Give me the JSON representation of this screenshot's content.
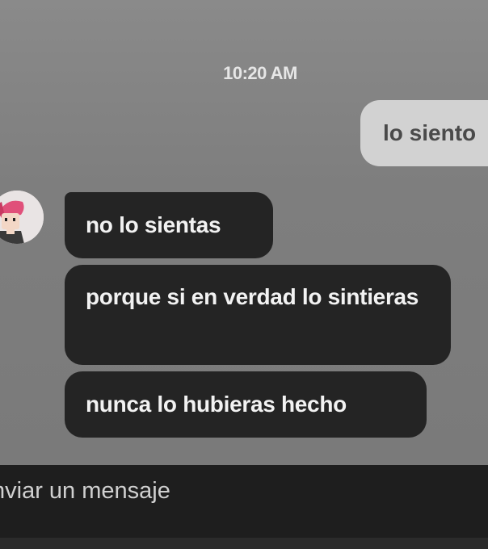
{
  "chat": {
    "timestamp": "10:20 AM",
    "messages": [
      {
        "direction": "outgoing",
        "text": "lo siento"
      },
      {
        "direction": "incoming",
        "text": "no lo sientas"
      },
      {
        "direction": "incoming",
        "text": "porque si en verdad lo sintieras"
      },
      {
        "direction": "incoming",
        "text": "nunca lo hubieras hecho"
      }
    ]
  },
  "composer": {
    "placeholder": "nviar un mensaje"
  },
  "colors": {
    "background": "#7e7e7e",
    "outgoing_bubble": "#d2d2d2",
    "incoming_bubble": "#242424",
    "input_bar": "#1e1e1e"
  },
  "icons": {
    "avatar": "avatar-pink-hair-character"
  }
}
